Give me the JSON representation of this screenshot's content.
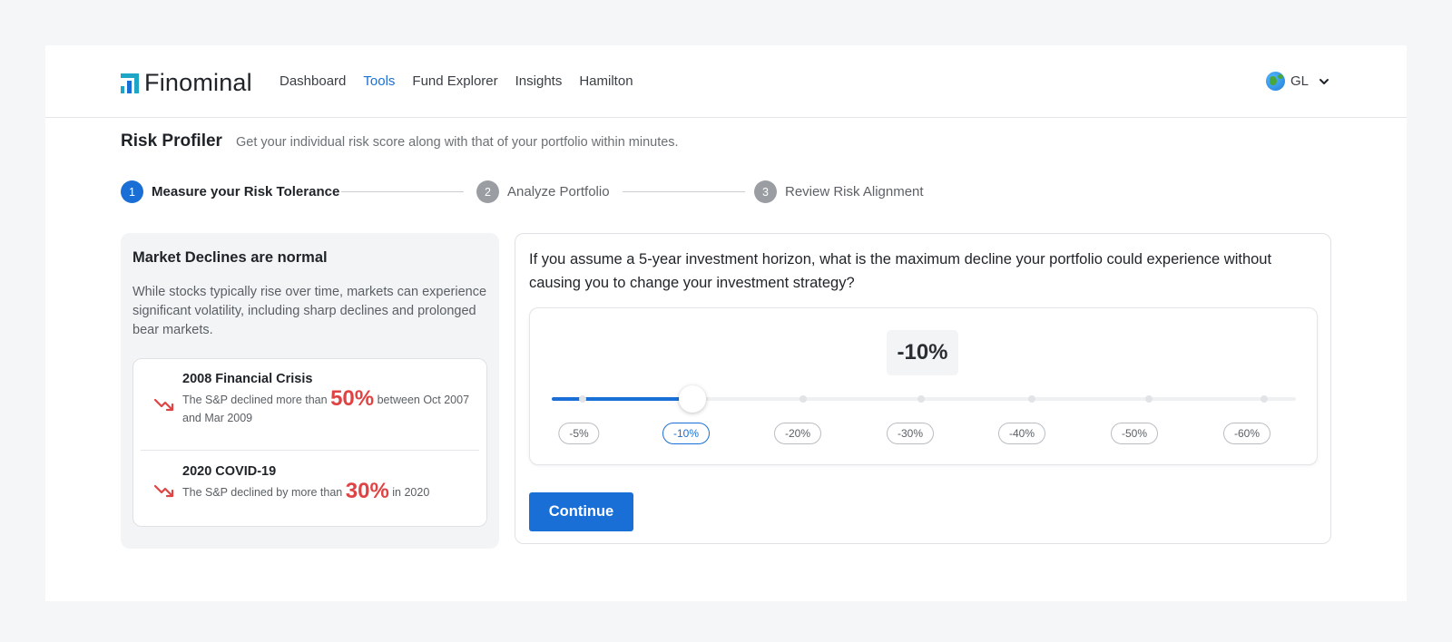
{
  "app": {
    "name": "Finominal"
  },
  "nav": {
    "items": [
      "Dashboard",
      "Tools",
      "Fund Explorer",
      "Insights",
      "Hamilton"
    ],
    "active": "Tools"
  },
  "region": {
    "label": "GL"
  },
  "page": {
    "title": "Risk Profiler",
    "subtitle": "Get your individual risk score along with that of your portfolio within minutes."
  },
  "steps": [
    {
      "num": "1",
      "label": "Measure your Risk Tolerance",
      "state": "active"
    },
    {
      "num": "2",
      "label": "Analyze Portfolio",
      "state": "pending"
    },
    {
      "num": "3",
      "label": "Review Risk Alignment",
      "state": "pending"
    }
  ],
  "info": {
    "title": "Market Declines are normal",
    "body": "While stocks typically rise over time, markets can experience significant volatility, including sharp declines and prolonged bear markets.",
    "crises": [
      {
        "name": "2008 Financial Crisis",
        "pre": "The S&P declined more than ",
        "value": "50%",
        "post": " between  Oct 2007 and Mar 2009"
      },
      {
        "name": "2020 COVID-19",
        "pre": "The S&P declined by more than ",
        "value": "30%",
        "post": " in 2020"
      }
    ]
  },
  "question": {
    "text": "If you assume a 5-year investment horizon, what is the maximum decline your portfolio could experience without causing you to change your investment strategy?",
    "selected": "-10%",
    "selected_index": 1,
    "options": [
      "-5%",
      "-10%",
      "-20%",
      "-30%",
      "-40%",
      "-50%",
      "-60%"
    ]
  },
  "continue_label": "Continue",
  "colors": {
    "accent": "#1a6fd6",
    "decline": "#e04343"
  }
}
